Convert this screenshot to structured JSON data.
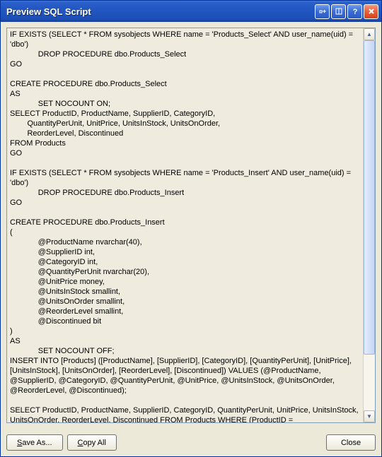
{
  "window": {
    "title": "Preview SQL Script"
  },
  "sql": {
    "content": "IF EXISTS (SELECT * FROM sysobjects WHERE name = 'Products_Select' AND user_name(uid) = 'dbo')\n             DROP PROCEDURE dbo.Products_Select\nGO\n\nCREATE PROCEDURE dbo.Products_Select\nAS\n             SET NOCOUNT ON;\nSELECT ProductID, ProductName, SupplierID, CategoryID,\n        QuantityPerUnit, UnitPrice, UnitsInStock, UnitsOnOrder,\n        ReorderLevel, Discontinued\nFROM Products\nGO\n\nIF EXISTS (SELECT * FROM sysobjects WHERE name = 'Products_Insert' AND user_name(uid) = 'dbo')\n             DROP PROCEDURE dbo.Products_Insert\nGO\n\nCREATE PROCEDURE dbo.Products_Insert\n(\n             @ProductName nvarchar(40),\n             @SupplierID int,\n             @CategoryID int,\n             @QuantityPerUnit nvarchar(20),\n             @UnitPrice money,\n             @UnitsInStock smallint,\n             @UnitsOnOrder smallint,\n             @ReorderLevel smallint,\n             @Discontinued bit\n)\nAS\n             SET NOCOUNT OFF;\nINSERT INTO [Products] ([ProductName], [SupplierID], [CategoryID], [QuantityPerUnit], [UnitPrice], [UnitsInStock], [UnitsOnOrder], [ReorderLevel], [Discontinued]) VALUES (@ProductName, @SupplierID, @CategoryID, @QuantityPerUnit, @UnitPrice, @UnitsInStock, @UnitsOnOrder, @ReorderLevel, @Discontinued);\n\nSELECT ProductID, ProductName, SupplierID, CategoryID, QuantityPerUnit, UnitPrice, UnitsInStock, UnitsOnOrder, ReorderLevel, Discontinued FROM Products WHERE (ProductID = SCOPE_IDENTITY())\nGO"
  },
  "buttons": {
    "save_as": "Save As...",
    "copy_all": "Copy All",
    "close": "Close"
  }
}
